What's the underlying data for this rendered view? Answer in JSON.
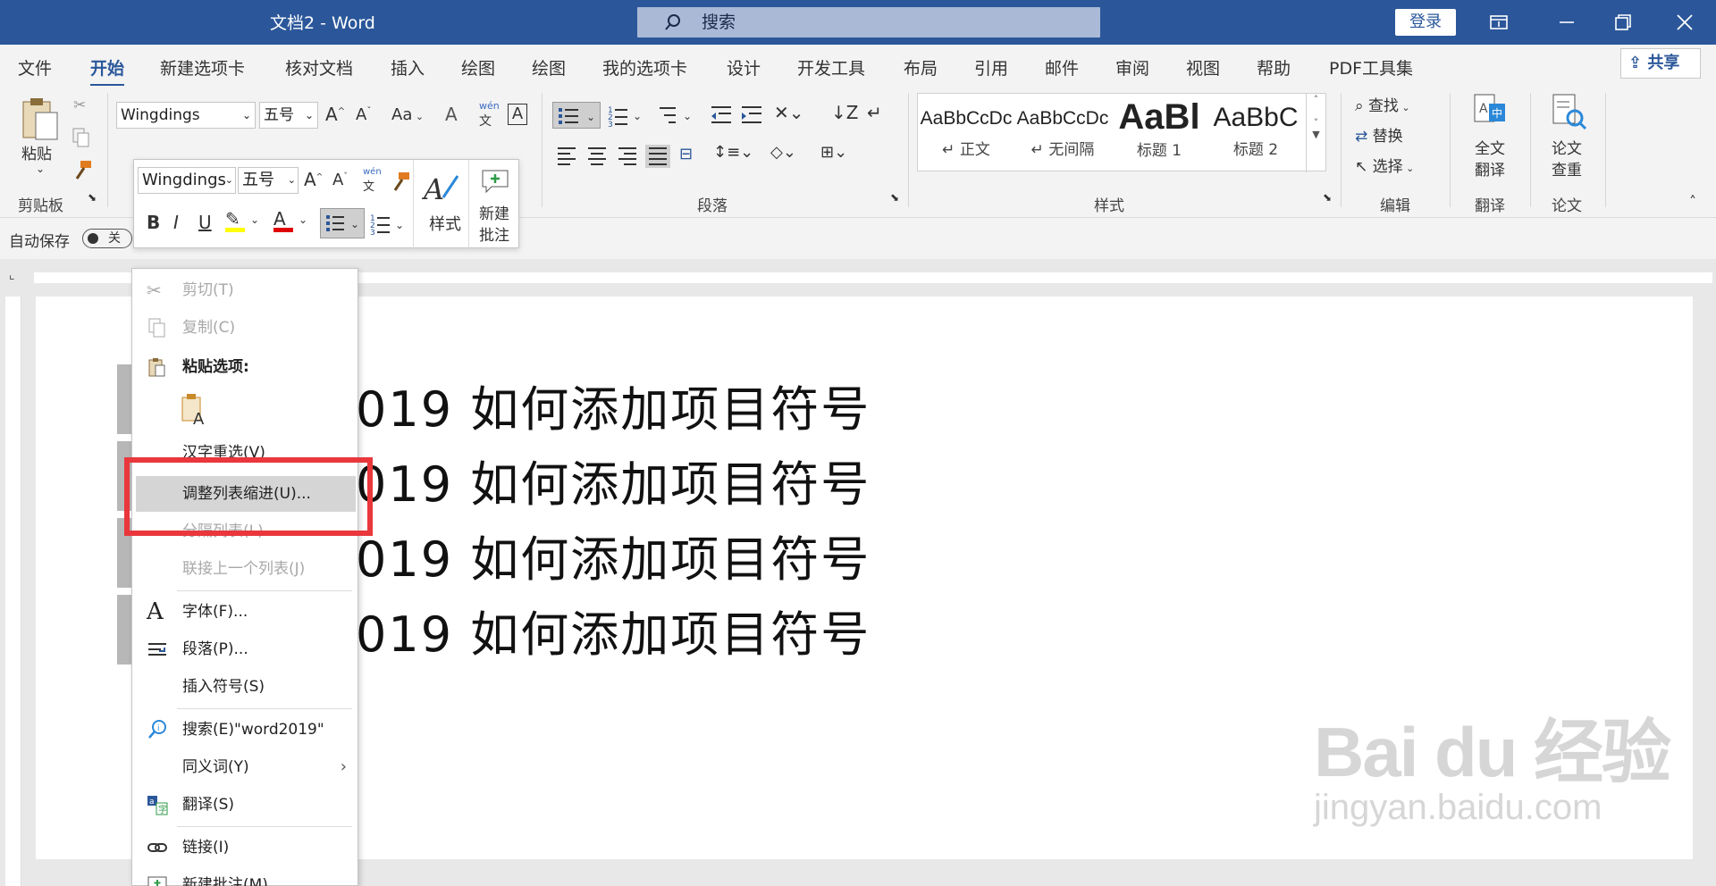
{
  "titlebar": {
    "title": "文档2  -  Word",
    "search_placeholder": "搜索",
    "login_label": "登录"
  },
  "menu": {
    "tabs": [
      "文件",
      "开始",
      "新建选项卡",
      "核对文档",
      "插入",
      "绘图",
      "绘图",
      "我的选项卡",
      "设计",
      "开发工具",
      "布局",
      "引用",
      "邮件",
      "审阅",
      "视图",
      "帮助",
      "PDF工具集"
    ],
    "active_tab": "开始",
    "share_label": "共享"
  },
  "ribbon": {
    "clipboard": {
      "paste_label": "粘贴",
      "group_label": "剪贴板"
    },
    "font": {
      "family": "Wingdings",
      "size": "五号",
      "case_label": "Aa",
      "pinyin_top": "wén",
      "pinyin_bottom": "文",
      "boxed_char": "A"
    },
    "paragraph": {
      "group_label": "段落"
    },
    "styles": {
      "group_label": "样式",
      "items": [
        {
          "sample": "AaBbCcDc",
          "name": "↵ 正文"
        },
        {
          "sample": "AaBbCcDc",
          "name": "↵ 无间隔"
        },
        {
          "sample": "AaBl",
          "name": "标题 1"
        },
        {
          "sample": "AaBbC",
          "name": "标题 2"
        }
      ]
    },
    "editing": {
      "find": "查找",
      "replace": "替换",
      "select": "选择",
      "group_label": "编辑"
    },
    "translate": {
      "full_label_1": "全文",
      "full_label_2": "翻译",
      "group_label": "翻译"
    },
    "paper": {
      "label_1": "论文",
      "label_2": "查重",
      "group_label": "论文"
    }
  },
  "qat": {
    "autosave_label": "自动保存",
    "autosave_state": "关"
  },
  "mini_toolbar": {
    "font_family": "Wingdings",
    "font_size": "五号",
    "styles_label": "样式",
    "new_comment_1": "新建",
    "new_comment_2": "批注",
    "highlight_color": "#ffff00",
    "font_color": "#e00000"
  },
  "document": {
    "lines": [
      "019 如何添加项目符号",
      "019 如何添加项目符号",
      "019 如何添加项目符号",
      "019 如何添加项目符号"
    ]
  },
  "context_menu": {
    "cut": "剪切(T)",
    "copy": "复制(C)",
    "paste_options": "粘贴选项:",
    "hanzi_reselect": "汉字重选(V)",
    "adjust_list_indent": "调整列表缩进(U)...",
    "separate_list": "分隔列表(L)",
    "join_previous_list": "联接上一个列表(J)",
    "font": "字体(F)...",
    "paragraph": "段落(P)...",
    "insert_symbol": "插入符号(S)",
    "search": "搜索(E)\"word2019\"",
    "synonyms": "同义词(Y)",
    "translate": "翻译(S)",
    "link": "链接(I)",
    "new_comment": "新建批注(M)"
  },
  "watermark": {
    "brand": "Bai du 经验",
    "url": "jingyan.baidu.com"
  },
  "colors": {
    "accent": "#2b579a",
    "highlight_box": "#e9373c",
    "hover": "#d5d5d5"
  }
}
